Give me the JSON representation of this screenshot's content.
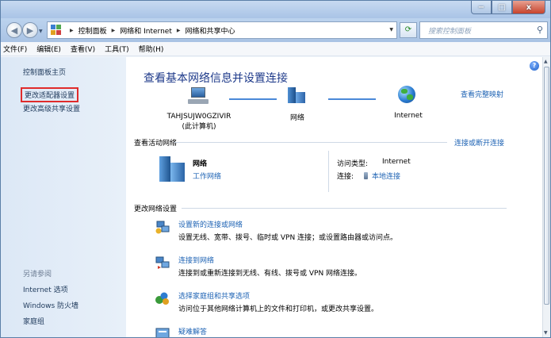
{
  "window": {
    "minimize": "−",
    "maximize": "□",
    "close": "x"
  },
  "address": {
    "crumbs": [
      "控制面板",
      "网络和 Internet",
      "网络和共享中心"
    ],
    "search_placeholder": "搜索控制面板"
  },
  "menu": [
    "文件(F)",
    "编辑(E)",
    "查看(V)",
    "工具(T)",
    "帮助(H)"
  ],
  "sidebar": {
    "items": [
      "控制面板主页",
      "更改适配器设置",
      "更改高级共享设置"
    ],
    "highlighted_index": 1,
    "see_also_title": "另请参阅",
    "see_also": [
      "Internet 选项",
      "Windows 防火墙",
      "家庭组"
    ]
  },
  "main": {
    "title": "查看基本网络信息并设置连接",
    "view_full_map": "查看完整映射",
    "map": {
      "computer_name": "TAHJSUJW0GZIVIR",
      "computer_sub": "(此计算机)",
      "network": "网络",
      "internet": "Internet"
    },
    "active_title": "查看活动网络",
    "connect_disconnect": "连接或断开连接",
    "active": {
      "name": "网络",
      "type": "工作网络",
      "access_type_label": "访问类型:",
      "access_type_value": "Internet",
      "connections_label": "连接:",
      "connections_value": "本地连接"
    },
    "change_title": "更改网络设置",
    "tasks": [
      {
        "link": "设置新的连接或网络",
        "desc": "设置无线、宽带、拨号、临时或 VPN 连接；或设置路由器或访问点。"
      },
      {
        "link": "连接到网络",
        "desc": "连接到或重新连接到无线、有线、拨号或 VPN 网络连接。"
      },
      {
        "link": "选择家庭组和共享选项",
        "desc": "访问位于其他网络计算机上的文件和打印机，或更改共享设置。"
      },
      {
        "link": "疑难解答",
        "desc": ""
      }
    ]
  },
  "colors": {
    "link": "#1e63b4",
    "title": "#1e3a8a",
    "highlight": "#e02b2b"
  }
}
